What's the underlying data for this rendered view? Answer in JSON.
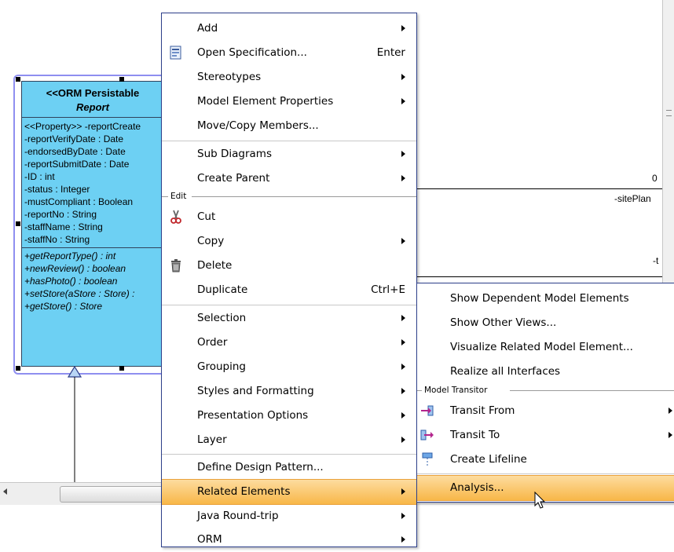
{
  "class_box": {
    "stereotype": "<<ORM Persistable",
    "name": "Report",
    "attributes": [
      "<<Property>> -reportCreate",
      "-reportVerifyDate : Date",
      "-endorsedByDate : Date",
      "-reportSubmitDate : Date",
      "-ID : int",
      "-status : Integer",
      "-mustCompliant : Boolean",
      "-reportNo : String",
      "-staffName : String",
      "-staffNo : String"
    ],
    "operations": [
      "+getReportType() : int",
      "+newReview() : boolean",
      "+hasPhoto() : boolean",
      "+setStore(aStore : Store) :",
      "+getStore() : Store"
    ]
  },
  "canvas_labels": {
    "multiplicity": "0",
    "role_site": "-sitePlan",
    "role_t": "-t"
  },
  "main_menu": {
    "items": {
      "add": "Add",
      "open_spec": "Open Specification...",
      "open_spec_shortcut": "Enter",
      "stereotypes": "Stereotypes",
      "model_elem_props": "Model Element Properties",
      "move_copy": "Move/Copy Members...",
      "sub_diagrams": "Sub Diagrams",
      "create_parent": "Create Parent",
      "cut": "Cut",
      "copy": "Copy",
      "delete": "Delete",
      "duplicate": "Duplicate",
      "duplicate_shortcut": "Ctrl+E",
      "selection": "Selection",
      "order": "Order",
      "grouping": "Grouping",
      "styles": "Styles and Formatting",
      "presentation": "Presentation Options",
      "layer": "Layer",
      "define_pattern": "Define Design Pattern...",
      "related": "Related Elements",
      "java_roundtrip": "Java Round-trip",
      "orm": "ORM"
    },
    "group_edit": "Edit"
  },
  "sub_menu": {
    "items": {
      "show_dependent": "Show Dependent Model Elements",
      "show_other_views": "Show Other Views...",
      "visualize_related": "Visualize Related Model Element...",
      "realize_interfaces": "Realize all Interfaces",
      "transit_from": "Transit From",
      "transit_to": "Transit To",
      "create_lifeline": "Create Lifeline",
      "analysis": "Analysis..."
    },
    "group_model_transitor": "Model Transitor"
  },
  "colors": {
    "class_fill": "#6dd0f3",
    "highlight": "#f8b748",
    "menu_border": "#2d3f8a",
    "selection_border": "#8f8ff0"
  }
}
